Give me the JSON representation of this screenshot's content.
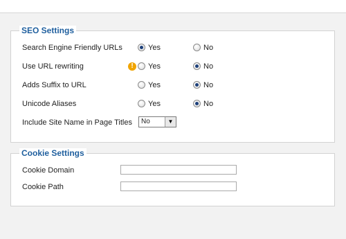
{
  "seo": {
    "title": "SEO Settings",
    "rows": [
      {
        "label": "Search Engine Friendly URLs",
        "yes": "Yes",
        "no": "No",
        "selected": "yes"
      },
      {
        "label": "Use URL rewriting",
        "yes": "Yes",
        "no": "No",
        "selected": "no",
        "warning_icon": "exclamation-icon"
      },
      {
        "label": "Adds Suffix to URL",
        "yes": "Yes",
        "no": "No",
        "selected": "no"
      },
      {
        "label": "Unicode Aliases",
        "yes": "Yes",
        "no": "No",
        "selected": "no"
      }
    ],
    "site_name": {
      "label": "Include Site Name in Page Titles",
      "value": "No"
    }
  },
  "cookie": {
    "title": "Cookie Settings",
    "domain": {
      "label": "Cookie Domain",
      "value": ""
    },
    "path": {
      "label": "Cookie Path",
      "value": ""
    }
  },
  "colors": {
    "legend": "#1f5f9e",
    "warning": "#f0a400",
    "radio_dot": "#1c3f7a"
  }
}
